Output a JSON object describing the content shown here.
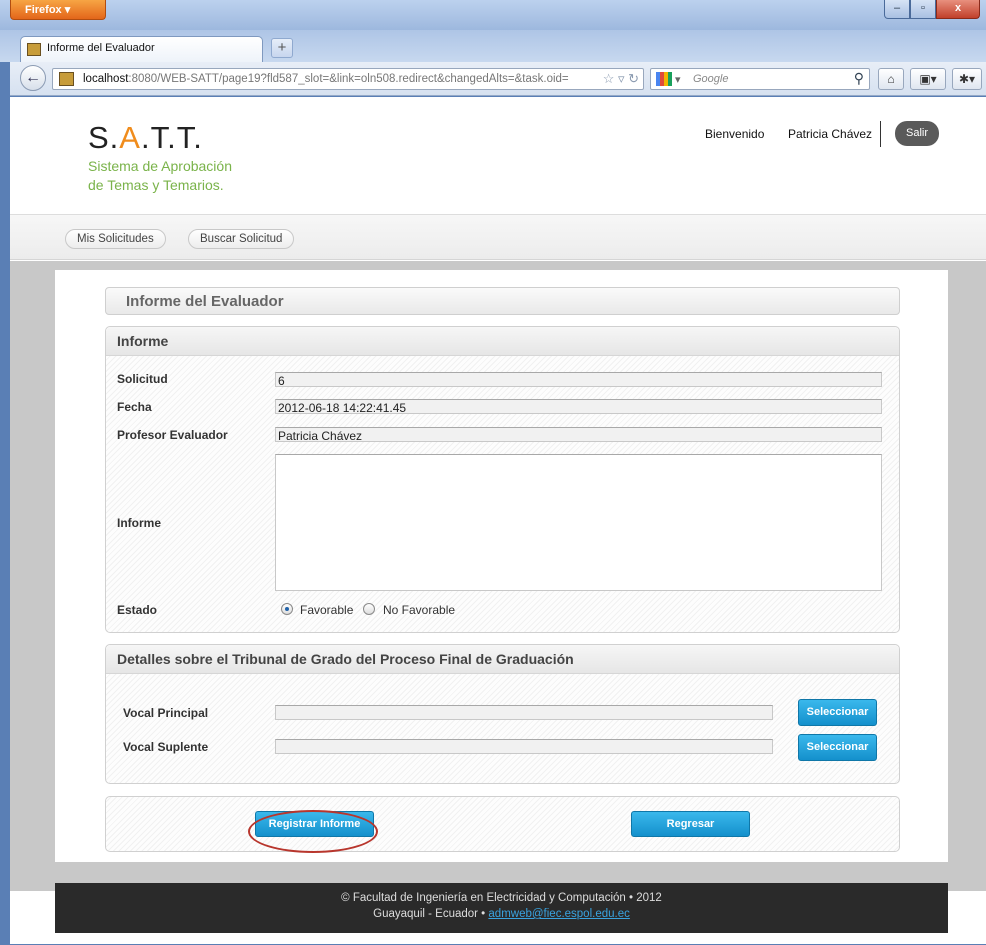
{
  "browser": {
    "app_button": "Firefox",
    "tab_title": "Informe del Evaluador",
    "url_host": "localhost",
    "url_rest": ":8080/WEB-SATT/page19?fld587_slot=&link=oln508.redirect&changedAlts=&task.oid=",
    "search_placeholder": "Google"
  },
  "header": {
    "logo_s": "S.",
    "logo_a": "A",
    "logo_tt": ".T.T.",
    "subtitle_line1": "Sistema de Aprobación",
    "subtitle_line2": "de Temas y Temarios.",
    "welcome": "Bienvenido",
    "user": "Patricia Chávez",
    "logout": "Salir"
  },
  "menu": {
    "items": [
      "Mis Solicitudes",
      "Buscar Solicitud"
    ]
  },
  "page": {
    "title": "Informe del Evaluador"
  },
  "informe": {
    "title": "Informe",
    "solicitud_label": "Solicitud",
    "solicitud_value": "6",
    "fecha_label": "Fecha",
    "fecha_value": "2012-06-18 14:22:41.45",
    "profesor_label": "Profesor Evaluador",
    "profesor_value": "Patricia Chávez",
    "informe_label": "Informe",
    "informe_value": "",
    "estado_label": "Estado",
    "estado_options": [
      "Favorable",
      "No Favorable"
    ],
    "estado_selected": "Favorable"
  },
  "tribunal": {
    "title": "Detalles sobre el Tribunal de Grado del Proceso Final de Graduación",
    "principal_label": "Vocal Principal",
    "principal_value": "",
    "suplente_label": "Vocal Suplente",
    "suplente_value": "",
    "select_label": "Seleccionar"
  },
  "actions": {
    "register": "Registrar Informe",
    "back": "Regresar"
  },
  "footer": {
    "line1": "© Facultad de Ingeniería en Electricidad y Computación • 2012",
    "line2_prefix": "Guayaquil - Ecuador • ",
    "email": "admweb@fiec.espol.edu.ec"
  },
  "colors": {
    "accent_orange": "#f08c1c",
    "subtitle_green": "#7ab34a",
    "button_blue": "#1490cc",
    "highlight_red": "#b8362d",
    "footer_bg": "#2a2a2a"
  }
}
